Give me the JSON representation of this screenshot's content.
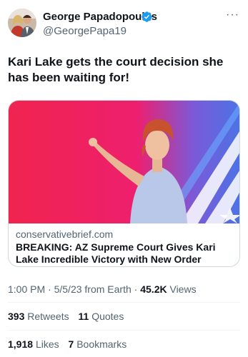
{
  "author": {
    "name": "George Papadopoulos",
    "handle": "@GeorgePapa19"
  },
  "tweet": {
    "text": "Kari Lake gets the court decision she has been waiting for!"
  },
  "card": {
    "domain": "conservativebrief.com",
    "title": "BREAKING: AZ Supreme Court Gives Kari Lake Incredible Victory with New Order"
  },
  "meta": {
    "time": "1:00 PM",
    "date": "5/5/23",
    "source": "from Earth",
    "views_count": "45.2K",
    "views_label": "Views"
  },
  "stats": {
    "retweets_count": "393",
    "retweets_label": "Retweets",
    "quotes_count": "11",
    "quotes_label": "Quotes",
    "likes_count": "1,918",
    "likes_label": "Likes",
    "bookmarks_count": "7",
    "bookmarks_label": "Bookmarks"
  },
  "colors": {
    "verified": "#1d9bf0",
    "secondary_text": "#536471",
    "primary_text": "#0f1419",
    "border": "#cfd9de"
  },
  "icons": [
    "verified-badge-icon",
    "more-options-icon"
  ]
}
